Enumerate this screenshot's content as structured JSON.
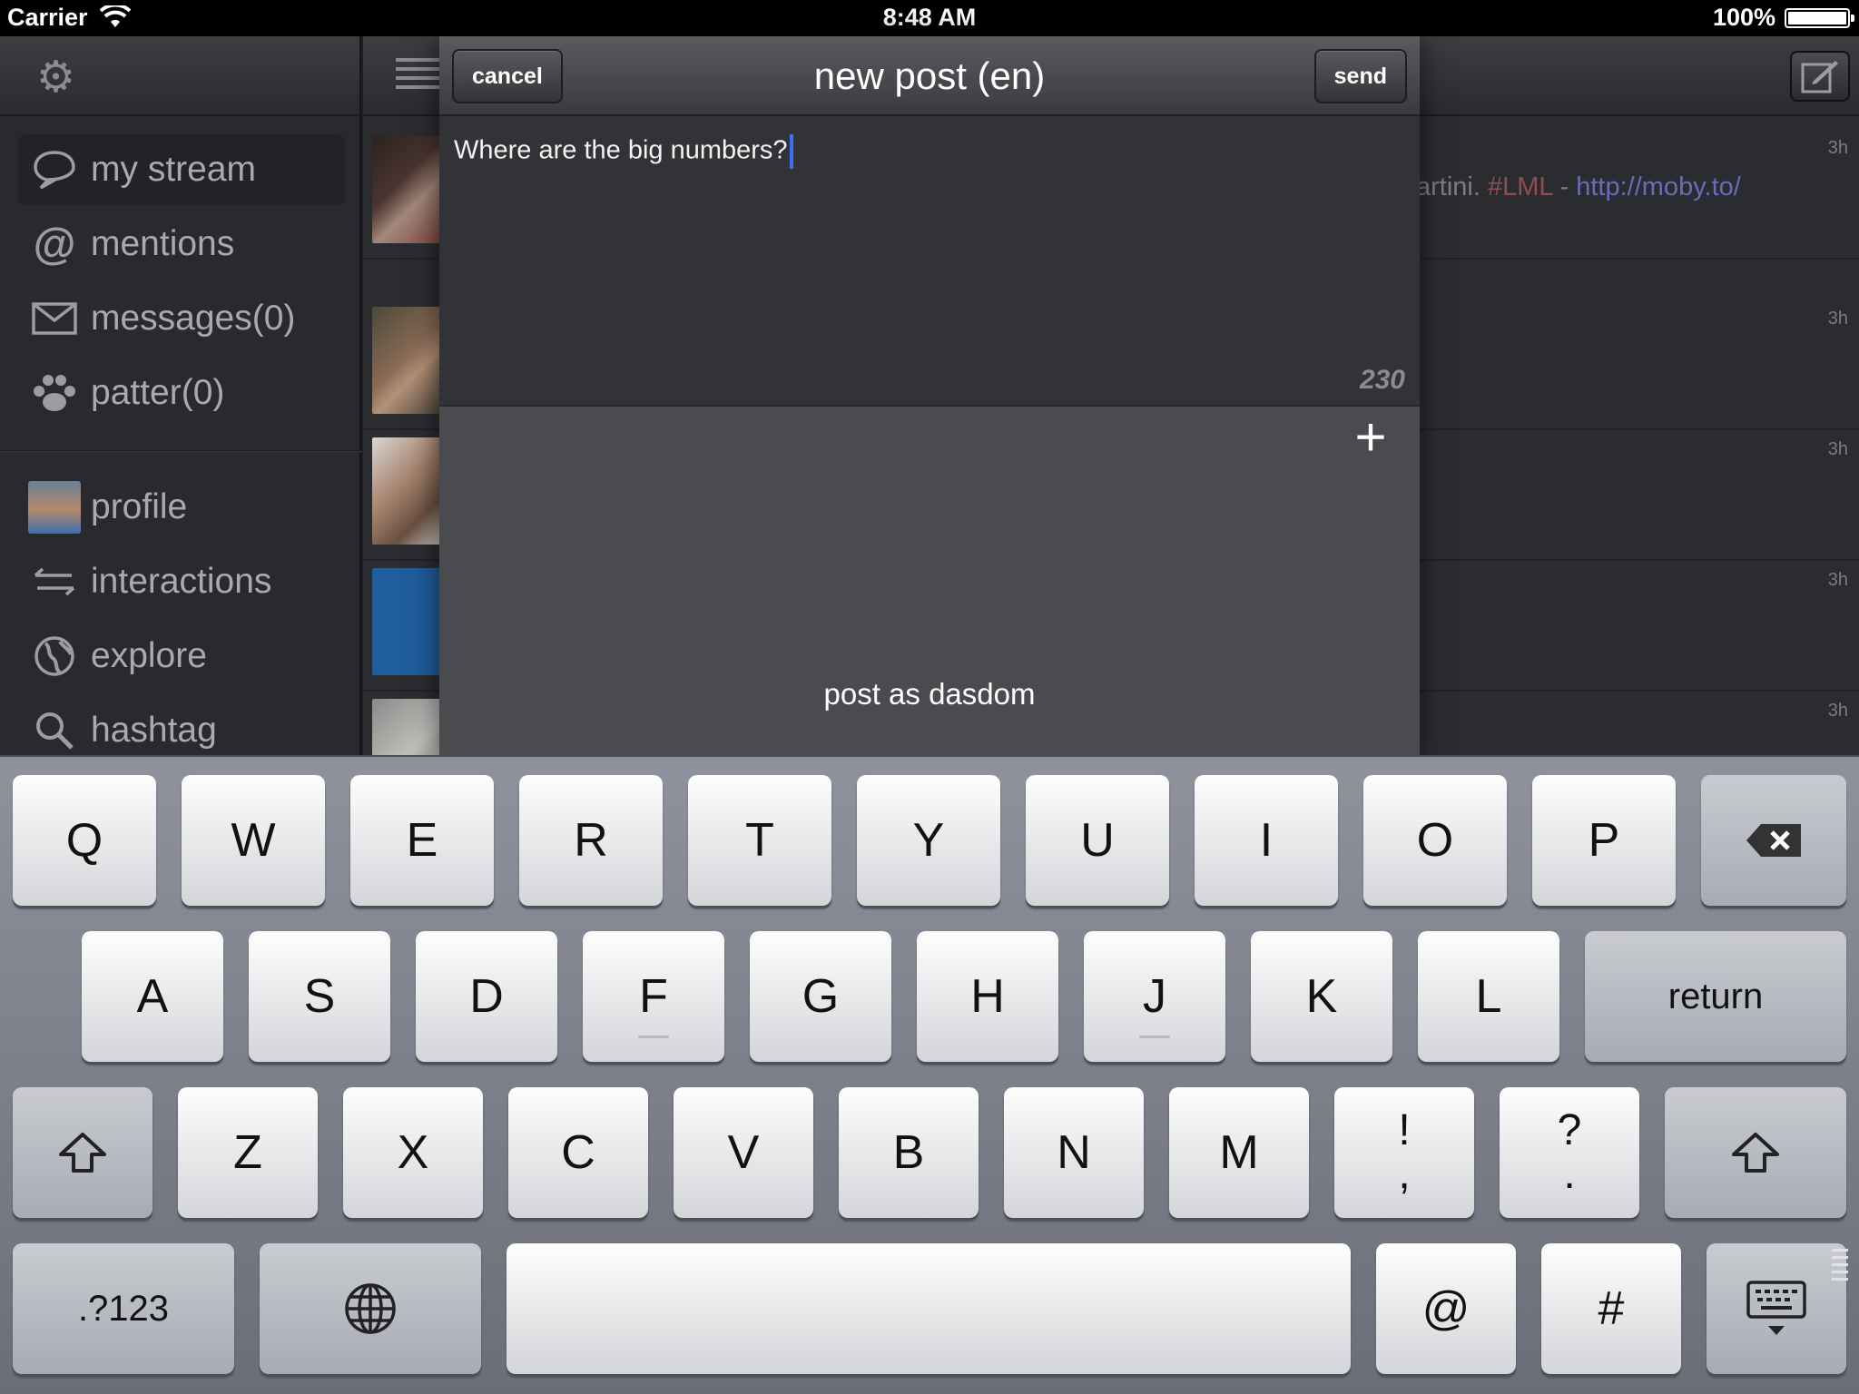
{
  "status_bar": {
    "carrier": "Carrier",
    "time": "8:48 AM",
    "battery": "100%",
    "battery_level": 1.0
  },
  "sidebar": {
    "items": [
      {
        "label": "my stream",
        "icon": "speech-bubble-icon",
        "active": true
      },
      {
        "label": "mentions",
        "icon": "at-icon"
      },
      {
        "label": "messages(0)",
        "icon": "envelope-icon"
      },
      {
        "label": "patter(0)",
        "icon": "paw-icon"
      },
      {
        "label": "profile",
        "icon": "avatar"
      },
      {
        "label": "interactions",
        "icon": "arrows-icon"
      },
      {
        "label": "explore",
        "icon": "globe-icon"
      },
      {
        "label": "hashtag",
        "icon": "search-icon"
      }
    ]
  },
  "stream": {
    "rows": [
      {
        "age": "3h",
        "snippet_text": "artini.",
        "snippet_hash": "#LML",
        "snippet_sep": " - ",
        "snippet_link": "http://moby.to/"
      },
      {
        "age": "3h"
      },
      {
        "age": "3h"
      },
      {
        "age": "3h"
      },
      {
        "age": "3h"
      }
    ]
  },
  "compose": {
    "title": "new post (en)",
    "cancel_label": "cancel",
    "send_label": "send",
    "text": "Where are the big numbers?",
    "counter": "230",
    "attach_label": "+",
    "post_as": "post as dasdom"
  },
  "keyboard": {
    "row1": [
      "Q",
      "W",
      "E",
      "R",
      "T",
      "Y",
      "U",
      "I",
      "O",
      "P"
    ],
    "row2": [
      "A",
      "S",
      "D",
      "F",
      "G",
      "H",
      "J",
      "K",
      "L"
    ],
    "row3": [
      "Z",
      "X",
      "C",
      "V",
      "B",
      "N",
      "M"
    ],
    "return_label": "return",
    "numbers_label": ".?123",
    "excl_top": "!",
    "excl_bottom": ",",
    "question_top": "?",
    "question_bottom": ".",
    "at_label": "@",
    "hash_label": "#"
  }
}
